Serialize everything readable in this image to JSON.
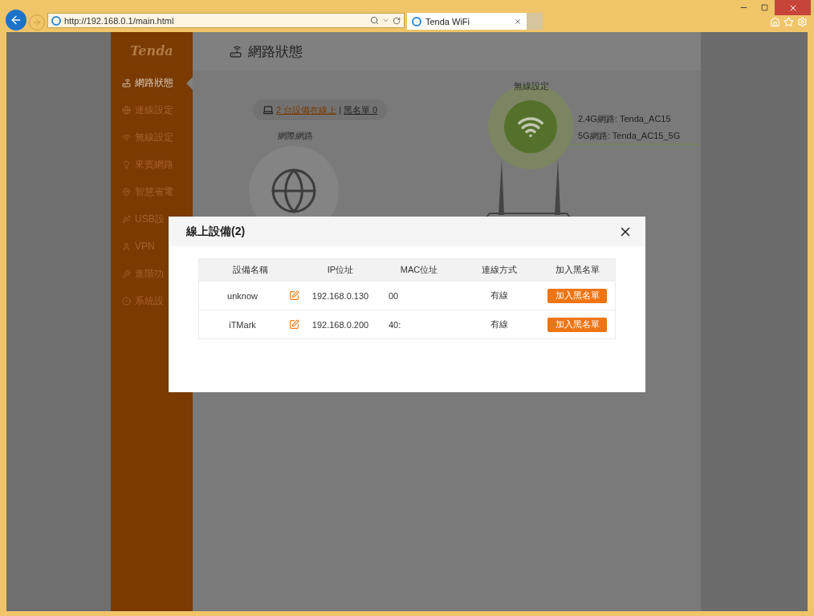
{
  "browser": {
    "address": "http://192.168.0.1/main.html",
    "tabs": [
      {
        "title": "Tenda WiFi",
        "selected": true
      }
    ]
  },
  "sidebar": {
    "logo": "Tenda",
    "items": [
      {
        "label": "網路狀態",
        "kind": "router",
        "selected": true
      },
      {
        "label": "連線設定",
        "kind": "globe",
        "selected": false
      },
      {
        "label": "無線設定",
        "kind": "wifi",
        "selected": false
      },
      {
        "label": "來賓網路",
        "kind": "bulb",
        "selected": false
      },
      {
        "label": "智慧省電",
        "kind": "pin",
        "selected": false
      },
      {
        "label": "USB設",
        "kind": "usb",
        "selected": false
      },
      {
        "label": "VPN",
        "kind": "user",
        "selected": false
      },
      {
        "label": "進階功",
        "kind": "wrench",
        "selected": false
      },
      {
        "label": "系統設",
        "kind": "gear",
        "selected": false
      }
    ]
  },
  "header": {
    "title": "網路狀態"
  },
  "status": {
    "devices_link": "2 台設備在線上",
    "separator": "|",
    "blacklist_link": "黑名單 0"
  },
  "internet": {
    "label": "網際網路"
  },
  "wireless": {
    "label": "無線設定",
    "networks": [
      "2.4G網路: Tenda_AC15",
      "5G網路: Tenda_AC15_5G"
    ]
  },
  "dialog": {
    "title": "線上設備(2)",
    "columns": [
      "設備名稱",
      "IP位址",
      "MAC位址",
      "連線方式",
      "加入黑名單"
    ],
    "rows": [
      {
        "name": "unknow",
        "ip": "192.168.0.130",
        "mac": "00",
        "connection": "有線",
        "action": "加入黑名單"
      },
      {
        "name": "iTMark",
        "ip": "192.168.0.200",
        "mac": "40:",
        "connection": "有線",
        "action": "加入黑名單"
      }
    ]
  }
}
